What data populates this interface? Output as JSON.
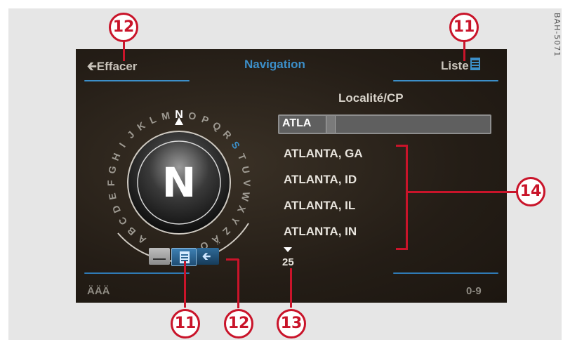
{
  "document_code": "BAH-5071",
  "header": {
    "left_label": "Effacer",
    "title": "Navigation",
    "right_label": "Liste"
  },
  "input": {
    "label": "Localité/CP",
    "value": "ATLA"
  },
  "results": [
    "ATLANTA, GA",
    "ATLANTA, ID",
    "ATLANTA, IL",
    "ATLANTA, IN"
  ],
  "result_count": "25",
  "speller": {
    "selected_letter": "N",
    "letters": [
      "A",
      "B",
      "C",
      "D",
      "E",
      "F",
      "G",
      "H",
      "I",
      "J",
      "K",
      "L",
      "M",
      "N",
      "O",
      "P",
      "Q",
      "R",
      "S",
      "T",
      "U",
      "V",
      "W",
      "X",
      "Y",
      "Z",
      "Ä",
      "Ö"
    ]
  },
  "footer": {
    "left": "ÄÄÄ",
    "right": "0-9"
  },
  "callouts": {
    "c12_top": "12",
    "c11_top": "11",
    "c14": "14",
    "c11_bottom": "11",
    "c12_bottom": "12",
    "c13": "13"
  },
  "colors": {
    "accent": "#3c8fc9",
    "callout": "#c9142a",
    "screen_bg": "#241d16"
  }
}
